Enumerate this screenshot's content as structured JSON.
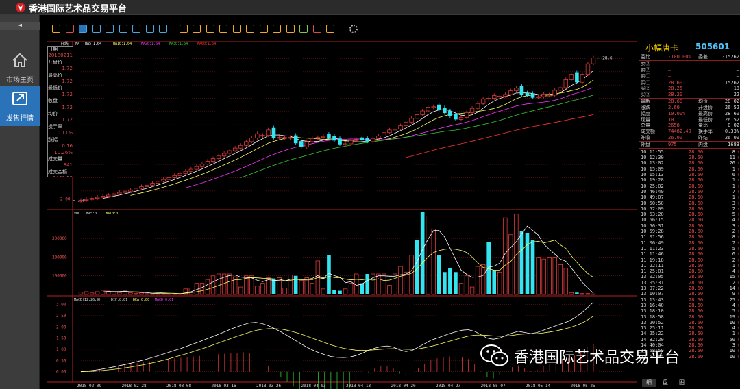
{
  "app": {
    "title": "香港国际艺术品交易平台"
  },
  "nav": {
    "collapse": "◄",
    "items": [
      {
        "label": "市场主页",
        "icon": "home-icon"
      },
      {
        "label": "发售行情",
        "icon": "external-link-icon"
      }
    ]
  },
  "toolbar": {
    "icons": [
      "bar-chart-icon",
      "line-chart-icon",
      "candlestick-icon",
      "calendar-icon",
      "day-icon",
      "week-icon",
      "month-icon",
      "season-icon",
      "year-icon",
      "min1-icon",
      "min5-icon",
      "min15-icon",
      "min30-icon",
      "min60-icon",
      "custom-period-icon",
      "indicator-icon",
      "switch-icon",
      "tick-icon",
      "zoom-in-icon",
      "zoom-out-icon",
      "draw-icon",
      "settings-icon"
    ]
  },
  "chart_data": [
    {
      "type": "candlestick",
      "panel": "price",
      "period_label": "日线",
      "ma_labels": [
        "MA5:1.64",
        "MA10:1.64",
        "MA20:1.64",
        "MA30:1.64",
        "MA60:1.64"
      ],
      "ma_colors": [
        "#ffffff",
        "#ffff66",
        "#ff33ff",
        "#33cc33",
        "#ff3333"
      ],
      "ma_prefix": "MA",
      "y_ticks": [
        2.0
      ],
      "first_price_label": "1.9",
      "last_price_label": "28.6",
      "closes": [
        1.72,
        1.9,
        2.1,
        2.3,
        2.5,
        2.7,
        2.95,
        3.2,
        3.45,
        3.7,
        4.0,
        4.3,
        4.6,
        4.95,
        5.3,
        5.65,
        6.0,
        6.4,
        6.8,
        7.2,
        7.6,
        8.1,
        8.6,
        9.1,
        9.6,
        10.1,
        10.6,
        11.1,
        11.6,
        12.1,
        12.8,
        13.5,
        14.3,
        14.0,
        15.0,
        13.5,
        13.6,
        13.6,
        13.6,
        12.5,
        11.8,
        12.8,
        13.4,
        13.6,
        13.8,
        13.5,
        13.0,
        12.3,
        12.4,
        13.0,
        13.2,
        13.1,
        12.8,
        13.4,
        13.9,
        14.5,
        15.0,
        15.2,
        15.8,
        16.5,
        17.2,
        17.9,
        18.6,
        19.3,
        19.4,
        18.8,
        18.2,
        17.6,
        17.0,
        17.4,
        18.3,
        19.1,
        20.0,
        20.9,
        21.0,
        21.5,
        21.4,
        21.7,
        22.4,
        22.9,
        21.6,
        21.5,
        21.1,
        21.3,
        21.8,
        21.6,
        22.5,
        23.0,
        24.5,
        25.5,
        24.0,
        25.5,
        27.5,
        28.6
      ],
      "up_colors_note": "red hollow up, cyan filled down",
      "down_idx": [
        35,
        39,
        40,
        45,
        46,
        47,
        51,
        52,
        65,
        66,
        67,
        68,
        80,
        81,
        82,
        90
      ]
    },
    {
      "type": "bar",
      "panel": "volume",
      "label": "VOL",
      "ma_labels": [
        "MA5:0",
        "MA10:0"
      ],
      "y_ticks": [
        "300000",
        "200000",
        "100000"
      ],
      "y_tick_values": [
        300000,
        200000,
        100000
      ],
      "ylim": [
        0,
        440000
      ],
      "values": [
        12000,
        15000,
        8000,
        15000,
        22000,
        18000,
        14000,
        10000,
        22000,
        9000,
        6000,
        8000,
        4000,
        3000,
        2000,
        3000,
        2000,
        3000,
        4000,
        30000,
        35000,
        60000,
        60000,
        80000,
        100000,
        110000,
        110000,
        110000,
        95000,
        40000,
        100000,
        100000,
        45000,
        60000,
        90000,
        85000,
        90000,
        35000,
        105000,
        100000,
        75000,
        90000,
        60000,
        180000,
        30000,
        210000,
        25000,
        20000,
        30000,
        60000,
        110000,
        60000,
        110000,
        110000,
        110000,
        110000,
        50000,
        110000,
        150000,
        120000,
        210000,
        290000,
        440000,
        420000,
        350000,
        210000,
        120000,
        140000,
        120000,
        60000,
        100000,
        40000,
        150000,
        160000,
        280000,
        130000,
        120000,
        410000,
        320000,
        430000,
        340000,
        330000,
        290000,
        200000,
        190000,
        200000,
        200000,
        160000,
        140000,
        10000,
        10000,
        5000,
        5000,
        3000
      ],
      "down_idx": [
        35,
        39,
        45,
        46,
        47,
        51,
        52,
        61,
        62,
        65,
        66,
        67,
        68,
        74,
        75,
        80,
        81,
        82,
        90
      ]
    },
    {
      "type": "line",
      "panel": "macd",
      "label": "MACD(12,26,9)",
      "legend": [
        "DIF:0.01",
        "DEA:0.00",
        "MACD:0.01"
      ],
      "y_ticks": [
        "3.00",
        "2.50",
        "2.00",
        "1.50",
        "1.00",
        "0.50",
        "0.00"
      ],
      "y_tick_values": [
        3.0,
        2.5,
        2.0,
        1.5,
        1.0,
        0.5,
        0.0
      ],
      "ylim": [
        -0.1,
        3.2
      ],
      "x_labels": [
        "2018-02-09",
        "2018-02-28",
        "2018-03-08",
        "2018-03-16",
        "2018-03-26",
        "2018-04-03",
        "2018-04-13",
        "2018-04-20",
        "2018-04-27",
        "2018-05-07",
        "2018-05-14",
        "2018-05-25"
      ],
      "dif": [
        0.01,
        0.03,
        0.06,
        0.1,
        0.15,
        0.2,
        0.26,
        0.32,
        0.38,
        0.45,
        0.52,
        0.6,
        0.68,
        0.77,
        0.86,
        0.95,
        1.04,
        1.14,
        1.24,
        1.34,
        1.45,
        1.56,
        1.67,
        1.78,
        1.9,
        2.0,
        2.1,
        2.18,
        2.2,
        2.15,
        2.05,
        1.92,
        1.78,
        1.62,
        1.45,
        1.28,
        1.12,
        0.98,
        0.86,
        0.76,
        0.68,
        0.64,
        0.63,
        0.65,
        0.72,
        0.82,
        0.95,
        1.05,
        1.12,
        1.15,
        1.1,
        0.98,
        0.9,
        0.95,
        1.1,
        1.25,
        1.4,
        1.5,
        1.6,
        1.7,
        1.78,
        1.85,
        1.87,
        1.8,
        1.65,
        1.5,
        1.45,
        1.5,
        1.62,
        1.72,
        1.8,
        1.75,
        1.7,
        1.75,
        1.85,
        1.95,
        2.05,
        2.15,
        2.25,
        2.4,
        2.6,
        2.85,
        3.1
      ],
      "dea": [
        0.0,
        0.01,
        0.02,
        0.04,
        0.07,
        0.1,
        0.13,
        0.17,
        0.21,
        0.26,
        0.31,
        0.37,
        0.43,
        0.5,
        0.57,
        0.65,
        0.73,
        0.81,
        0.9,
        0.99,
        1.08,
        1.18,
        1.28,
        1.38,
        1.48,
        1.58,
        1.67,
        1.76,
        1.84,
        1.89,
        1.92,
        1.92,
        1.9,
        1.85,
        1.78,
        1.7,
        1.6,
        1.5,
        1.4,
        1.3,
        1.2,
        1.12,
        1.05,
        1.0,
        0.96,
        0.95,
        0.96,
        0.98,
        1.0,
        1.02,
        1.03,
        1.02,
        1.0,
        1.0,
        1.02,
        1.07,
        1.13,
        1.2,
        1.28,
        1.36,
        1.44,
        1.52,
        1.59,
        1.63,
        1.64,
        1.62,
        1.6,
        1.58,
        1.59,
        1.62,
        1.66,
        1.68,
        1.69,
        1.7,
        1.73,
        1.77,
        1.82,
        1.88,
        1.95,
        2.04,
        2.15,
        2.3,
        2.48
      ]
    }
  ],
  "info_box": {
    "rows": [
      {
        "label": "日期",
        "value": "20180211"
      },
      {
        "label": "开盘价",
        "value": "1.72"
      },
      {
        "label": "最高价",
        "value": "1.72"
      },
      {
        "label": "最低价",
        "value": "1.72"
      },
      {
        "label": "收盘",
        "value": "1.72"
      },
      {
        "label": "均价",
        "value": "1.72"
      },
      {
        "label": "换手率",
        "value": "0.11%"
      },
      {
        "label": "涨幅",
        "value": "0.16 10.26%"
      },
      {
        "label": "成交量",
        "value": "841"
      },
      {
        "label": "成交金额",
        "value": "1446.52"
      }
    ]
  },
  "right_panel": {
    "name": "小幅唐卡",
    "code": "505601",
    "quote_rows": [
      {
        "a": "委比",
        "b": "-100.00%",
        "c": "委差",
        "d": "-15262"
      },
      {
        "a": "卖③",
        "b": "—",
        "c": "",
        "d": "—"
      },
      {
        "a": "卖②",
        "b": "—",
        "c": "",
        "d": "—"
      },
      {
        "a": "卖①",
        "b": "—",
        "c": "",
        "d": "—"
      },
      {
        "a": "买①",
        "b": "28.60",
        "c": "",
        "d": "15262"
      },
      {
        "a": "买②",
        "b": "28.25",
        "c": "",
        "d": "18"
      },
      {
        "a": "买③",
        "b": "28.20",
        "c": "",
        "d": "22"
      },
      {
        "a": "最新",
        "b": "28.60",
        "c": "均价",
        "d": "28.02"
      },
      {
        "a": "涨跌",
        "b": "2.60",
        "c": "开盘价",
        "d": "26.52"
      },
      {
        "a": "幅度",
        "b": "10.00%",
        "c": "最高价",
        "d": "28.60"
      },
      {
        "a": "现量",
        "b": "10",
        "c": "最低价",
        "d": "26.52"
      },
      {
        "a": "总量",
        "b": "2658",
        "c": "量比",
        "d": "0.02"
      },
      {
        "a": "成交额",
        "b": "74482.40",
        "c": "换手率",
        "d": "0.33%"
      },
      {
        "a": "昨收",
        "b": "26.00",
        "c": "昨结",
        "d": "26.00"
      },
      {
        "a": "外盘",
        "b": "975",
        "c": "内盘",
        "d": "1683"
      }
    ],
    "ticks": [
      {
        "t": "10:11:55",
        "p": "28.60",
        "v": "8"
      },
      {
        "t": "10:12:30",
        "p": "28.60",
        "v": "11"
      },
      {
        "t": "10:13:02",
        "p": "28.60",
        "v": "26"
      },
      {
        "t": "10:15:09",
        "p": "28.60",
        "v": "1"
      },
      {
        "t": "10:15:13",
        "p": "28.60",
        "v": "6"
      },
      {
        "t": "10:19:28",
        "p": "28.60",
        "v": "1"
      },
      {
        "t": "10:25:02",
        "p": "28.60",
        "v": "1"
      },
      {
        "t": "10:46:49",
        "p": "28.60",
        "v": "7"
      },
      {
        "t": "10:49:07",
        "p": "28.60",
        "v": "1"
      },
      {
        "t": "10:50:50",
        "p": "28.60",
        "v": "3"
      },
      {
        "t": "10:52:09",
        "p": "28.60",
        "v": "2"
      },
      {
        "t": "10:53:20",
        "p": "28.60",
        "v": "5"
      },
      {
        "t": "10:56:15",
        "p": "28.60",
        "v": "4"
      },
      {
        "t": "10:56:31",
        "p": "28.60",
        "v": "3"
      },
      {
        "t": "10:59:28",
        "p": "28.60",
        "v": "2"
      },
      {
        "t": "11:01:56",
        "p": "28.60",
        "v": "8"
      },
      {
        "t": "11:06:49",
        "p": "28.60",
        "v": "7"
      },
      {
        "t": "11:11:23",
        "p": "28.60",
        "v": "5"
      },
      {
        "t": "11:11:46",
        "p": "28.60",
        "v": "6"
      },
      {
        "t": "11:19:18",
        "p": "28.60",
        "v": "2"
      },
      {
        "t": "11:22:11",
        "p": "28.60",
        "v": "1"
      },
      {
        "t": "11:25:01",
        "p": "28.60",
        "v": "4"
      },
      {
        "t": "13:02:05",
        "p": "28.60",
        "v": "15"
      },
      {
        "t": "13:05:31",
        "p": "28.60",
        "v": "2"
      },
      {
        "t": "13:07:22",
        "p": "28.60",
        "v": "14"
      },
      {
        "t": "13:10:07",
        "p": "28.60",
        "v": "9"
      },
      {
        "t": "13:13:43",
        "p": "28.60",
        "v": "25"
      },
      {
        "t": "13:16:40",
        "p": "28.60",
        "v": "4"
      },
      {
        "t": "13:18:10",
        "p": "28.60",
        "v": "5"
      },
      {
        "t": "13:18:58",
        "p": "28.60",
        "v": "19"
      },
      {
        "t": "13:20:52",
        "p": "28.60",
        "v": "10"
      },
      {
        "t": "13:25:11",
        "p": "28.60",
        "v": "4"
      },
      {
        "t": "14:25:22",
        "p": "28.60",
        "v": "1"
      },
      {
        "t": "14:32:20",
        "p": "28.60",
        "v": "50"
      },
      {
        "t": "14:40:04",
        "p": "28.60",
        "v": "3"
      },
      {
        "t": "14:58:50",
        "p": "28.60",
        "v": "10"
      },
      {
        "t": "15:54:05",
        "p": "28.60",
        "v": "10"
      }
    ],
    "tabs": [
      "细",
      "盘",
      "图"
    ]
  },
  "watermark": {
    "text": "香港国际艺术品交易平台"
  }
}
